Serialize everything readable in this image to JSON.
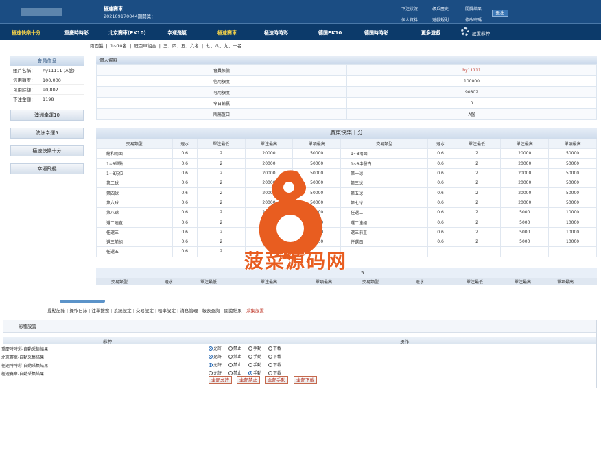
{
  "header": {
    "title": "極速賽車",
    "period": "202109170044期開獎：",
    "links_row1": [
      "下注狀況",
      "帳戶歷史",
      "開獎結果"
    ],
    "links_row2": [
      "個人資料",
      "遊戲規則",
      "修改密碼"
    ],
    "logout": "退出"
  },
  "nav": {
    "items": [
      "極速快樂十分",
      "重慶時時彩",
      "北京賽車(PK10)",
      "幸運飛艇",
      "極速賽車",
      "極速時時彩",
      "德国PK10",
      "德国時時彩",
      "更多遊戲"
    ],
    "active_index": 0,
    "highlight_index": 4,
    "settings": "設置彩种"
  },
  "subnav": [
    "兩面盤",
    "|",
    "1~10名",
    "|",
    "冠亞軍組合",
    "|",
    "三、四、五、六名",
    "|",
    "七、八、九、十名"
  ],
  "sidebar": {
    "title": "會員信息",
    "rows": [
      {
        "label": "賬戶名稱：",
        "value": "hy11111 (A盤)"
      },
      {
        "label": "信用額度：",
        "value": "100,000"
      },
      {
        "label": "可用餘額：",
        "value": "90,802"
      },
      {
        "label": "下注金額：",
        "value": "1198"
      }
    ],
    "buttons": [
      "澳洲幸運10",
      "澳洲幸運5",
      "極速快樂十分",
      "幸運飛艇"
    ]
  },
  "profile": {
    "title": "個人資料",
    "rows": [
      {
        "label": "會員帳號",
        "value": "hy11111"
      },
      {
        "label": "信用額度",
        "value": "100000"
      },
      {
        "label": "可用額度",
        "value": "90802"
      },
      {
        "label": "今日輸贏",
        "value": "0"
      },
      {
        "label": "所屬盤口",
        "value": "A盤"
      }
    ]
  },
  "odds": {
    "title": "廣東快樂十分",
    "headers": [
      "交易類型",
      "退水",
      "單注最低",
      "單注最高",
      "單項最高",
      "交易類型",
      "退水",
      "單注最低",
      "單注最高",
      "單項最高"
    ],
    "rows": [
      [
        "總和兩面",
        "0.6",
        "2",
        "20000",
        "50000",
        "1~8兩面",
        "0.6",
        "2",
        "20000",
        "50000"
      ],
      [
        "1~8單點",
        "0.6",
        "2",
        "20000",
        "50000",
        "1~8中發白",
        "0.6",
        "2",
        "20000",
        "50000"
      ],
      [
        "1~8方位",
        "0.6",
        "2",
        "20000",
        "50000",
        "第一球",
        "0.6",
        "2",
        "20000",
        "50000"
      ],
      [
        "第二球",
        "0.6",
        "2",
        "20000",
        "50000",
        "第三球",
        "0.6",
        "2",
        "20000",
        "50000"
      ],
      [
        "第四球",
        "0.6",
        "2",
        "20000",
        "50000",
        "第五球",
        "0.6",
        "2",
        "20000",
        "50000"
      ],
      [
        "第六球",
        "0.6",
        "2",
        "20000",
        "50000",
        "第七球",
        "0.6",
        "2",
        "20000",
        "50000"
      ],
      [
        "第八球",
        "0.6",
        "2",
        "20000",
        "50000",
        "任選二",
        "0.6",
        "2",
        "5000",
        "10000"
      ],
      [
        "選二連直",
        "0.6",
        "2",
        "5000",
        "10000",
        "選二連組",
        "0.6",
        "2",
        "5000",
        "10000"
      ],
      [
        "任選三",
        "0.6",
        "2",
        "5000",
        "10000",
        "選三前直",
        "0.6",
        "2",
        "5000",
        "10000"
      ],
      [
        "選三前組",
        "0.6",
        "2",
        "5000",
        "10000",
        "任選四",
        "0.6",
        "2",
        "5000",
        "10000"
      ],
      [
        "任選五",
        "0.6",
        "2",
        "",
        "",
        "",
        "",
        "",
        "",
        ""
      ]
    ]
  },
  "odds2": {
    "title": "5",
    "headers": [
      "交易類型",
      "退水",
      "單注最低",
      "單注最高",
      "單項最高",
      "交易類型",
      "退水",
      "單注最低",
      "單注最高",
      "單項最高"
    ]
  },
  "admin": {
    "tabs": [
      "提點記錄",
      "操作日誌",
      "注單搜索",
      "系統設定",
      "交易設定",
      "賠率設定",
      "消息管理",
      "報表查詢",
      "開獎結果",
      "采集設置"
    ],
    "box_title": "彩種設置",
    "col_lottery": "彩种",
    "col_action": "操作",
    "radio_labels": [
      "允許",
      "禁止",
      "手動",
      "下載"
    ],
    "rows": [
      {
        "name": "重慶時時彩-自動采集結果",
        "selected": 0
      },
      {
        "name": "北京賽車-自動采集結果",
        "selected": 0
      },
      {
        "name": "極速時時彩-自動采集結果",
        "selected": 0
      },
      {
        "name": "極速賽車-自動采集結果",
        "selected": 2
      }
    ],
    "buttons": [
      "全部允許",
      "全部禁止",
      "全部手動",
      "全部下載"
    ]
  },
  "watermark": "菠菜源码网",
  "colors": {
    "header_bg": "#1b4d83",
    "nav_bg": "#0c3a6a",
    "nav_highlight": "#f3d14a",
    "watermark": "#e85d20"
  }
}
